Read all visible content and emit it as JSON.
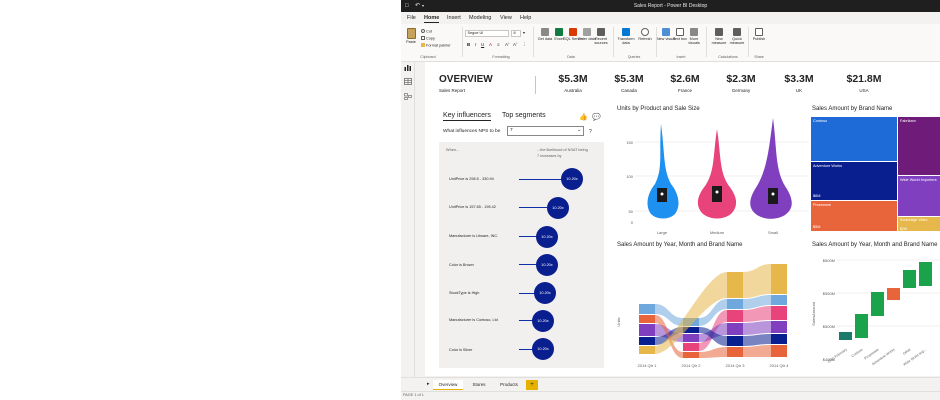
{
  "window": {
    "title": "Sales Report - Power BI Desktop"
  },
  "menu": {
    "tabs": [
      "File",
      "Home",
      "Insert",
      "Modeling",
      "View",
      "Help"
    ]
  },
  "ribbon": {
    "paste": "Paste",
    "cut": "Cut",
    "copy": "Copy",
    "format_painter": "Format painter",
    "clipboard_group": "Clipboard",
    "font_name": "Segoe UI",
    "font_size": "8",
    "formatting_group": "Formatting",
    "get_data": "Get data",
    "excel": "Excel",
    "sql_server": "SQL Server",
    "enter_data": "Enter data",
    "recent_sources": "Recent sources",
    "data_group": "Data",
    "transform_data": "Transform data",
    "refresh": "Refresh",
    "queries_group": "Queries",
    "new_visual": "New visual",
    "text_box": "Text box",
    "more_visuals": "More visuals",
    "insert_group": "Insert",
    "new_measure": "New measure",
    "quick_measure": "Quick measure",
    "calculations_group": "Calculations",
    "publish": "Publish",
    "share_group": "Share"
  },
  "overview": {
    "title": "OVERVIEW",
    "subtitle": "Sales Report"
  },
  "kpis": [
    {
      "value": "$5.3M",
      "label": "Australia"
    },
    {
      "value": "$5.3M",
      "label": "Canada"
    },
    {
      "value": "$2.6M",
      "label": "France"
    },
    {
      "value": "$2.3M",
      "label": "Germany"
    },
    {
      "value": "$3.3M",
      "label": "UK"
    },
    {
      "value": "$21.8M",
      "label": "USA"
    }
  ],
  "key_influencers": {
    "tab1": "Key influencers",
    "tab2": "Top segments",
    "question": "What influences NPS to be",
    "selected": "7",
    "col_when": "When...",
    "col_likelihood": "...the likelihood of NSAT being 7 increases by",
    "items": [
      {
        "label": "UnitPrice is 298.5 - 330.94",
        "value": "10.20x"
      },
      {
        "label": "UnitPrice is 157.65 - 195.42",
        "value": "10.20x"
      },
      {
        "label": "Manufacturer is Litware, INC.",
        "value": "10.20x"
      },
      {
        "label": "Color is Brown",
        "value": "10.20x"
      },
      {
        "label": "StockType is High",
        "value": "10.20x"
      },
      {
        "label": "Manufacturer is Contoso, Ltd",
        "value": "10.20x"
      },
      {
        "label": "Color is Silver",
        "value": "10.20x"
      }
    ]
  },
  "violin": {
    "title": "Units by Product and Sale Size",
    "yticks": [
      "150",
      "100",
      "50",
      "0"
    ],
    "categories": [
      "Large",
      "Medium",
      "Small"
    ],
    "colors": [
      "#1e90f0",
      "#e8437a",
      "#7f3fbf"
    ]
  },
  "treemap": {
    "title": "Sales Amount by Brand Name",
    "cells": [
      {
        "name": "Contoso",
        "value": "",
        "color": "#1e6bd8"
      },
      {
        "name": "Fabrikam",
        "value": "",
        "color": "#6e1b7a"
      },
      {
        "name": "Adventure Works",
        "value": "$6M",
        "color": "#0a1f8f"
      },
      {
        "name": "Wide World Importers",
        "value": "",
        "color": "#7f3fbf"
      },
      {
        "name": "Proseware",
        "value": "$5M",
        "color": "#e8643a"
      },
      {
        "name": "Southridge Video",
        "value": "$2M",
        "color": "#e6b74b"
      }
    ]
  },
  "ribbon_chart": {
    "title": "Sales Amount by Year, Month and Brand Name",
    "ylabel": "Units",
    "x": [
      "2014 Qtr 1",
      "2014 Qtr 2",
      "2014 Qtr 3",
      "2014 Qtr 4"
    ]
  },
  "waterfall": {
    "title": "Sales Amount by Year, Month and Brand Name",
    "ylabel": "SalesAmount",
    "yticks": [
      "$600M",
      "$550M",
      "$500M",
      "$450M"
    ],
    "x": [
      "2013 February",
      "Contoso",
      "Proseware",
      "Adventure Works",
      "Other",
      "Wide World Imp..."
    ]
  },
  "page_tabs": [
    "Overview",
    "Stores",
    "Products"
  ],
  "status": {
    "page": "PAGE 1 of 1"
  },
  "chart_data": [
    {
      "type": "bar",
      "title": "Sales Amount by Brand Name",
      "categories": [
        "Adventure Works",
        "Proseware",
        "Southridge Video"
      ],
      "values": [
        6,
        5,
        2
      ],
      "ylabel": "$M"
    }
  ]
}
